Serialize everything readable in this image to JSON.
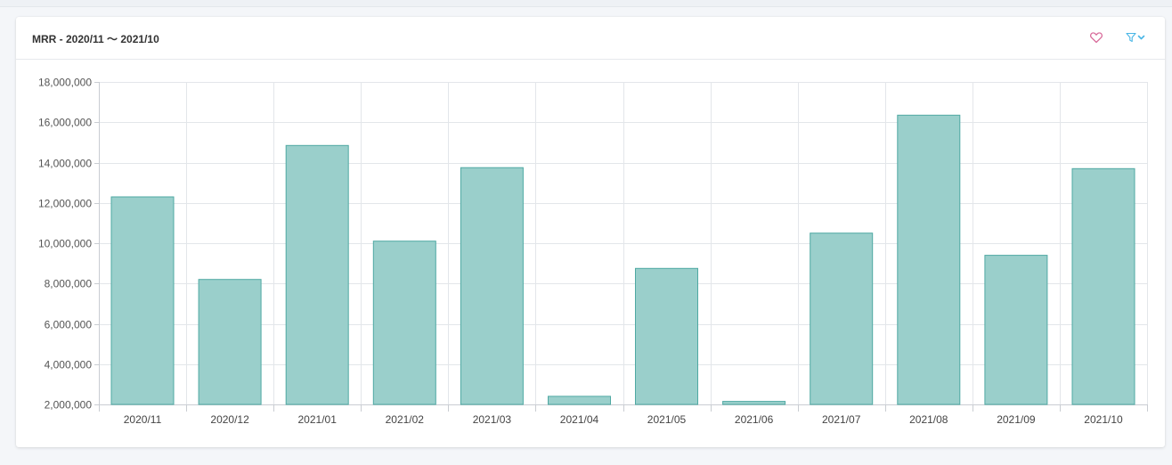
{
  "card": {
    "title": "MRR - 2020/11 ～ 2021/10",
    "favorite_icon": "heart-icon",
    "filter_icon": "filter-icon"
  },
  "colors": {
    "bar_fill": "#9acfcb",
    "bar_stroke": "#4fa9a3",
    "grid": "#e3e6ea",
    "heart": "#d86b9a",
    "filter": "#49b6e6"
  },
  "chart_data": {
    "type": "bar",
    "title": "",
    "xlabel": "",
    "ylabel": "",
    "categories": [
      "2020/11",
      "2020/12",
      "2021/01",
      "2021/02",
      "2021/03",
      "2021/04",
      "2021/05",
      "2021/06",
      "2021/07",
      "2021/08",
      "2021/09",
      "2021/10"
    ],
    "values": [
      12300000,
      8200000,
      14850000,
      10100000,
      13750000,
      2400000,
      8750000,
      2150000,
      10500000,
      16350000,
      9400000,
      13700000
    ],
    "ylim": [
      2000000,
      18000000
    ],
    "yticks": [
      "2,000,000",
      "4,000,000",
      "6,000,000",
      "8,000,000",
      "10,000,000",
      "12,000,000",
      "14,000,000",
      "16,000,000",
      "18,000,000"
    ],
    "grid": true,
    "legend": "none"
  }
}
